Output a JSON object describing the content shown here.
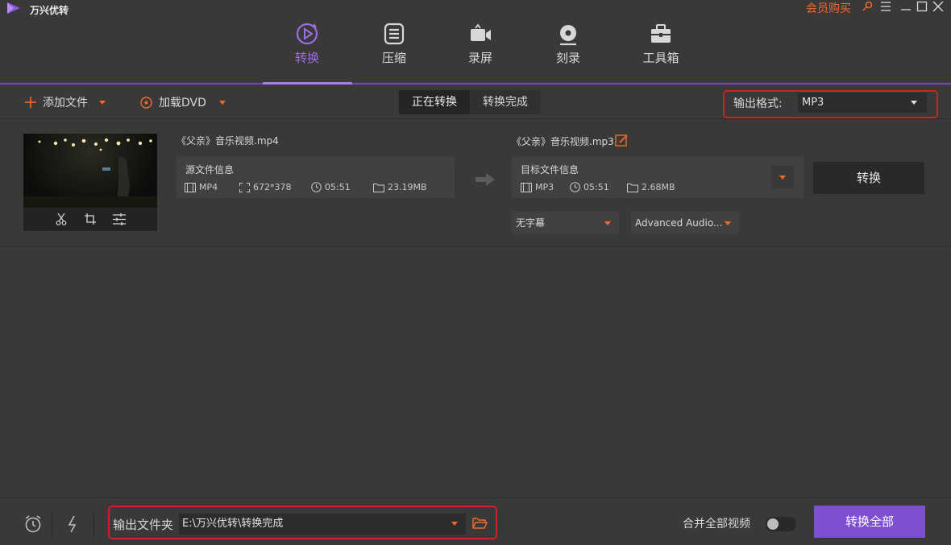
{
  "app": {
    "title": "万兴优转",
    "vip_label": "会员购买"
  },
  "nav": {
    "items": [
      {
        "label": "转换",
        "icon": "convert-icon",
        "active": true
      },
      {
        "label": "压缩",
        "icon": "compress-icon",
        "active": false
      },
      {
        "label": "录屏",
        "icon": "record-icon",
        "active": false
      },
      {
        "label": "刻录",
        "icon": "burn-disc-icon",
        "active": false
      },
      {
        "label": "工具箱",
        "icon": "toolbox-icon",
        "active": false
      }
    ]
  },
  "toolbar": {
    "add_file": "添加文件",
    "load_dvd": "加载DVD",
    "tabs": [
      "正在转换",
      "转换完成"
    ],
    "output_format_label": "输出格式:",
    "output_format_value": "MP3"
  },
  "file": {
    "source_name": "《父亲》音乐视频.mp4",
    "source_info_title": "源文件信息",
    "source_format": "MP4",
    "source_resolution": "672*378",
    "source_duration": "05:51",
    "source_size": "23.19MB",
    "target_name": "《父亲》音乐视频.mp3",
    "target_info_title": "目标文件信息",
    "target_format": "MP3",
    "target_duration": "05:51",
    "target_size": "2.68MB",
    "convert_label": "转换",
    "subtitle_option": "无字幕",
    "audio_option": "Advanced Audio..."
  },
  "bottom": {
    "output_folder_label": "输出文件夹",
    "output_folder_path": "E:\\万兴优转\\转换完成",
    "merge_label": "合并全部视频",
    "merge_enabled": false,
    "convert_all_label": "转换全部"
  },
  "colors": {
    "accent": "#7d4fd1",
    "orange": "#ef6a2d",
    "highlight": "#d0202a"
  }
}
